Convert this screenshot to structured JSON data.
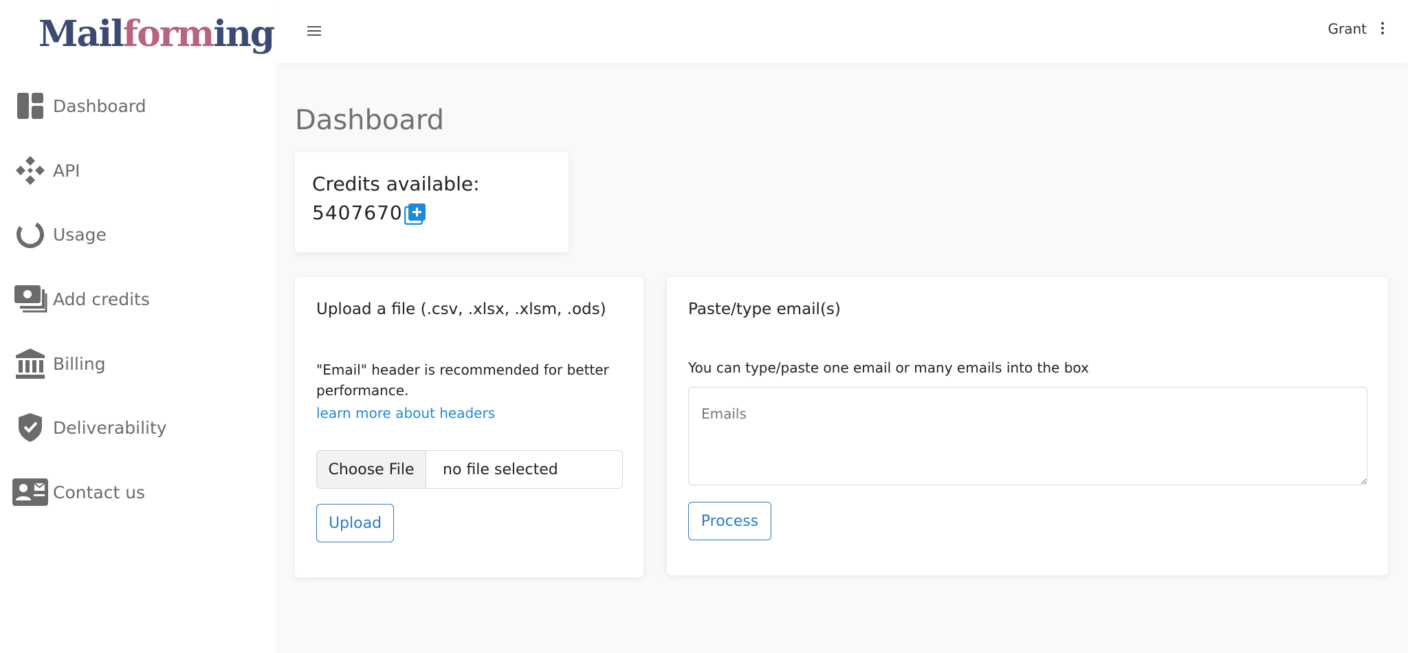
{
  "brand": {
    "part1": "Mail",
    "part2": "form",
    "part3": "ing",
    "swoosh": "»"
  },
  "sidebar": {
    "items": [
      {
        "label": "Dashboard",
        "icon": "dashboard-icon"
      },
      {
        "label": "API",
        "icon": "api-icon"
      },
      {
        "label": "Usage",
        "icon": "usage-icon"
      },
      {
        "label": "Add credits",
        "icon": "money-icon"
      },
      {
        "label": "Billing",
        "icon": "bank-icon"
      },
      {
        "label": "Deliverability",
        "icon": "shield-check-icon"
      },
      {
        "label": "Contact us",
        "icon": "contact-card-icon"
      }
    ]
  },
  "topbar": {
    "user_name": "Grant",
    "menu_icon": "hamburger-icon",
    "more_icon": "kebab-icon"
  },
  "page": {
    "title": "Dashboard"
  },
  "credits": {
    "label": "Credits available:",
    "value": "5407670",
    "add_icon": "add-credits-icon"
  },
  "upload": {
    "title": "Upload a file (.csv, .xlsx, .xlsm, .ods)",
    "hint": "\"Email\" header is recommended for better performance.",
    "link": "learn more about headers",
    "file_button": "Choose File",
    "file_status": "no file selected",
    "submit_label": "Upload"
  },
  "paste": {
    "title": "Paste/type email(s)",
    "hint": "You can type/paste one email or many emails into the box",
    "placeholder": "Emails",
    "value": "",
    "submit_label": "Process"
  },
  "colors": {
    "accent": "#2a7bc8",
    "link": "#1f8ad6",
    "brand_dark": "#3c4a73",
    "brand_pink": "#b8637f",
    "nav_icon": "#6b6b6b"
  }
}
